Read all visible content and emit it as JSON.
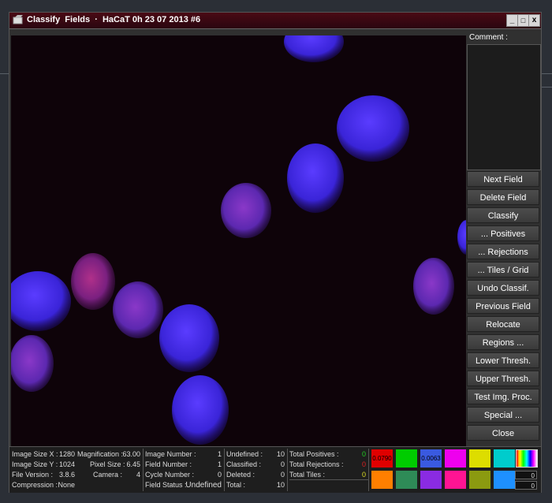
{
  "window": {
    "title": "Classify  Fields  ·  HaCaT 0h 23 07 2013 #6",
    "minimize": "_",
    "maximize": "□",
    "close": "x"
  },
  "comment": {
    "label": "Comment :"
  },
  "buttons": [
    "Next Field",
    "Delete Field",
    "Classify",
    "... Positives",
    "... Rejections",
    "... Tiles / Grid",
    "Undo Classif.",
    "Previous Field",
    "Relocate",
    "Regions ...",
    "Lower Thresh.",
    "Upper Thresh.",
    "Test Img. Proc.",
    "Special ...",
    "Close"
  ],
  "status": {
    "image_info": [
      {
        "k": "Image Size X :",
        "v": "1280"
      },
      {
        "k": "Image Size Y :",
        "v": "1024"
      },
      {
        "k": "File Version :",
        "v": "3.8.6"
      },
      {
        "k": "Compression :",
        "v": "None"
      }
    ],
    "optics": [
      {
        "k": "Magnification :",
        "v": "63.00"
      },
      {
        "k": "Pixel Size :",
        "v": "6.45"
      },
      {
        "k": "Camera :",
        "v": "4"
      }
    ],
    "field": [
      {
        "k": "Image Number :",
        "v": "1"
      },
      {
        "k": "Field Number :",
        "v": "1"
      },
      {
        "k": "Cycle Number :",
        "v": "0"
      },
      {
        "k": "Field Status :",
        "v": "Undefined"
      }
    ],
    "counts": [
      {
        "k": "Undefined :",
        "v": "10"
      },
      {
        "k": "Classified :",
        "v": "0"
      },
      {
        "k": "Deleted :",
        "v": "0"
      },
      {
        "k": "Total :",
        "v": "10"
      }
    ],
    "totals": [
      {
        "k": "Total Positives :",
        "v": "0",
        "color": "#22cc22"
      },
      {
        "k": "Total Rejections :",
        "v": "0",
        "color": "#dd2222"
      },
      {
        "k": "Total Tiles :",
        "v": "0",
        "color": "#dddd22"
      }
    ],
    "swatches_row1": [
      {
        "color": "#e00000",
        "label": "0.0790"
      },
      {
        "color": "#00cc00",
        "label": ""
      },
      {
        "color": "#3a5ae0",
        "label": "0.0063"
      },
      {
        "color": "#ee00ee",
        "label": ""
      },
      {
        "color": "#dddd00",
        "label": ""
      },
      {
        "color": "#00cccc",
        "label": ""
      }
    ],
    "swatches_row2": [
      {
        "color": "#ff7f00",
        "label": ""
      },
      {
        "color": "#2e8b57",
        "label": ""
      },
      {
        "color": "#8a2be2",
        "label": ""
      },
      {
        "color": "#ff1493",
        "label": ""
      },
      {
        "color": "#8b9a10",
        "label": ""
      },
      {
        "color": "#1e90ff",
        "label": ""
      }
    ],
    "field_values": [
      "0",
      "0"
    ]
  }
}
